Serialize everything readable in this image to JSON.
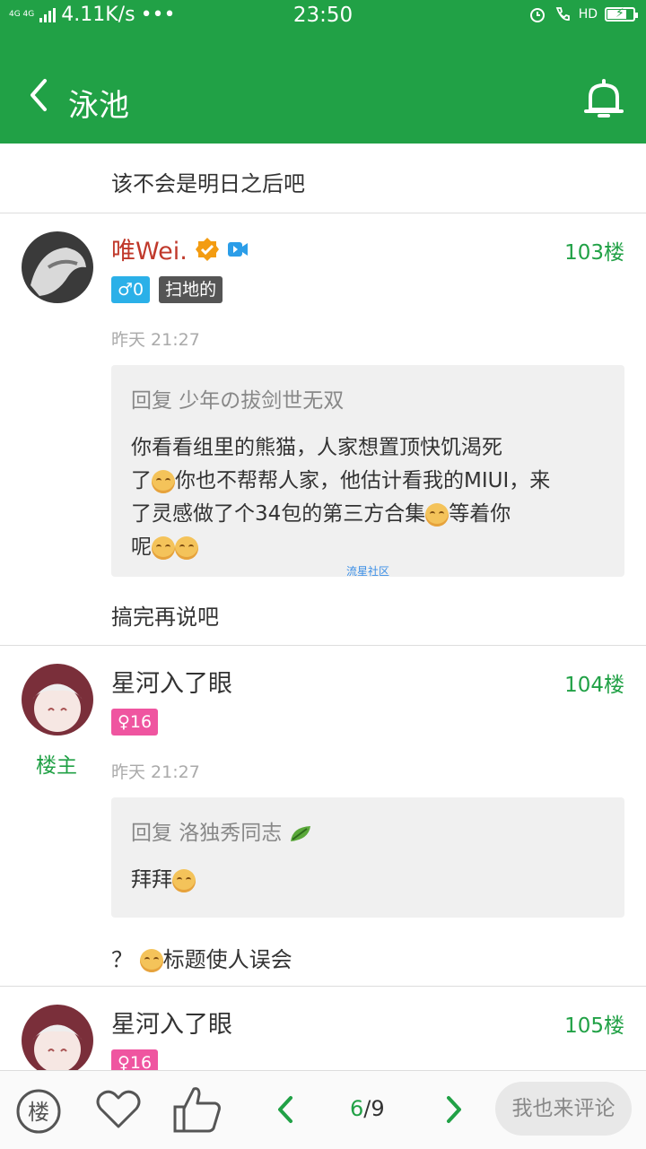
{
  "status": {
    "network": "4G 4G",
    "speed": "4.11K/s",
    "dots": "•••",
    "time": "23:50",
    "hd": "HD"
  },
  "header": {
    "title": "泳池"
  },
  "snippet": "该不会是明日之后吧",
  "posts": [
    {
      "username": "唯Wei.",
      "floor": "103楼",
      "gender": "♂0",
      "rank": "扫地的",
      "time": "昨天 21:27",
      "quote_head": "回复 少年の拔剑世无双",
      "quote_lines": [
        "你看看组里的熊猫，人家想置顶快饥渴死",
        "了",
        "你也不帮帮人家，他估计看我的MIUI，来",
        "了灵感做了个34包的第三方合集",
        "等着你",
        "呢"
      ],
      "quote_source": "流星社区",
      "reply": "搞完再说吧"
    },
    {
      "username": "星河入了眼",
      "owner": "楼主",
      "floor": "104楼",
      "gender": "♀16",
      "time": "昨天 21:27",
      "quote_head": "回复 洛独秀同志",
      "quote_body": "拜拜",
      "reply_prefix": "？",
      "reply": "标题使人误会"
    },
    {
      "username": "星河入了眼",
      "floor": "105楼",
      "gender": "♀16"
    }
  ],
  "bottom": {
    "floor_label": "楼",
    "page_current": "6",
    "page_total": "/9",
    "comment_placeholder": "我也来评论"
  },
  "colors": {
    "accent": "#21a146",
    "female": "#ef55a0",
    "male": "#2bb0e8"
  }
}
